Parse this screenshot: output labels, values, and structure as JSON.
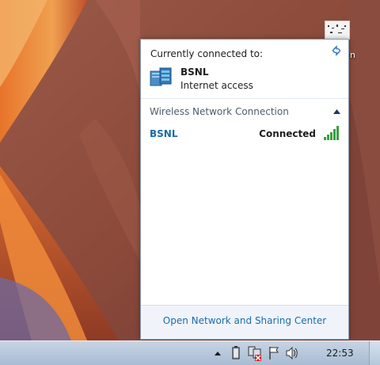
{
  "desktop": {
    "icon_label": "n"
  },
  "flyout": {
    "currently_connected_label": "Currently connected to:",
    "current_network": {
      "name": "BSNL",
      "status": "Internet access",
      "icon": "network-globe-icon"
    },
    "section": {
      "title": "Wireless Network Connection",
      "expanded": true
    },
    "networks": [
      {
        "name": "BSNL",
        "state": "Connected",
        "signal_bars": 5,
        "icon": "wifi-signal-icon"
      }
    ],
    "footer_link": "Open Network and Sharing Center",
    "colors": {
      "link": "#1c6ba6",
      "footer_bg": "#f0f4fa"
    }
  },
  "taskbar": {
    "clock": "22:53",
    "tray_icons": [
      "show-hidden-icons-icon",
      "power-icon",
      "network-disconnected-icon",
      "action-center-flag-icon",
      "volume-icon"
    ]
  }
}
